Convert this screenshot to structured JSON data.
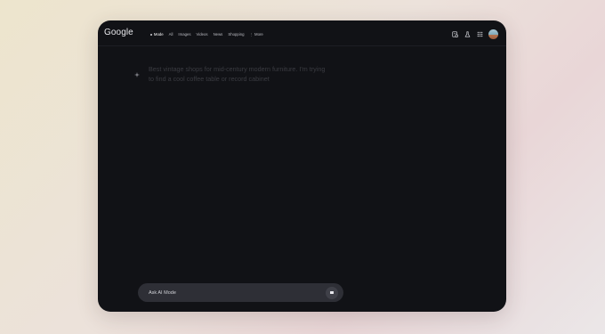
{
  "header": {
    "logo": "Google",
    "tabs": [
      {
        "label": "Mode",
        "active": true,
        "icon": "ai-mode-dot-icon"
      },
      {
        "label": "All"
      },
      {
        "label": "Images"
      },
      {
        "label": "Videos"
      },
      {
        "label": "News"
      },
      {
        "label": "Shopping"
      },
      {
        "label": "More",
        "icon": "more-vertical-icon"
      }
    ],
    "icons": [
      "history-icon",
      "labs-flask-icon",
      "apps-grid-icon"
    ]
  },
  "conversation": {
    "query_icon": "sparkle-icon",
    "query": "Best vintage shops for mid-century modern furniture. I'm trying to find a cool coffee table or record cabinet"
  },
  "ask": {
    "placeholder": "Ask AI Mode",
    "stop_icon": "stop-icon"
  },
  "colors": {
    "window_bg": "#111216",
    "input_bg": "#2e2f36",
    "query_text": "#3b3c42"
  }
}
